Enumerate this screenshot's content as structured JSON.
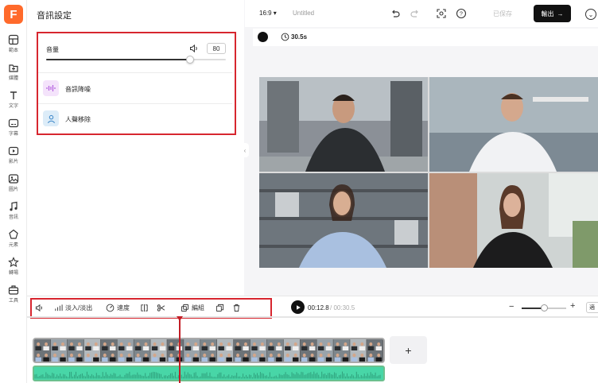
{
  "app": {
    "logo_letter": "F"
  },
  "rail": {
    "items": [
      {
        "label": "範本",
        "icon": "template-icon"
      },
      {
        "label": "媒體",
        "icon": "media-upload-icon"
      },
      {
        "label": "文字",
        "icon": "text-icon"
      },
      {
        "label": "字幕",
        "icon": "subtitle-icon"
      },
      {
        "label": "影片",
        "icon": "video-icon"
      },
      {
        "label": "圖片",
        "icon": "image-icon"
      },
      {
        "label": "音訊",
        "icon": "music-icon"
      },
      {
        "label": "元素",
        "icon": "elements-icon"
      },
      {
        "label": "轉場",
        "icon": "transition-icon"
      },
      {
        "label": "工具",
        "icon": "toolbox-icon"
      }
    ]
  },
  "panel": {
    "title": "音訊設定",
    "volume_label": "音量",
    "volume_value": "80",
    "volume_fraction": 0.8,
    "noise_label": "音訊降噪",
    "vocal_label": "人聲移除"
  },
  "topbar": {
    "ratio": "16:9",
    "title": "Untitled",
    "saved": "已保存",
    "export": "輸出"
  },
  "canvas": {
    "duration": "30.5s"
  },
  "timeline": {
    "fade": "淡入/淡出",
    "speed": "速度",
    "edit": "編組",
    "current": "00:12.8",
    "total": "/ 00:30.5",
    "zoom_fraction": 0.5,
    "fit": "適"
  },
  "colors": {
    "accent": "#d7262f",
    "audio": "#48d6a7",
    "logo": "#ff6a2b"
  }
}
